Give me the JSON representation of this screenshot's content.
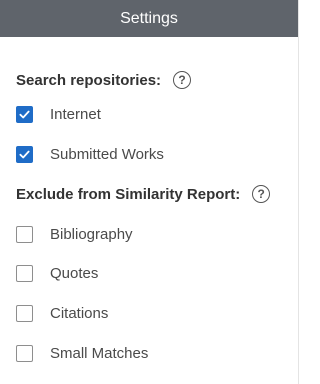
{
  "header": {
    "title": "Settings"
  },
  "search_repositories": {
    "title": "Search repositories:",
    "help_icon": "help-circle-icon",
    "options": [
      {
        "label": "Internet",
        "checked": true
      },
      {
        "label": "Submitted Works",
        "checked": true
      }
    ]
  },
  "exclude": {
    "title": "Exclude from Similarity Report:",
    "help_icon": "help-circle-icon",
    "options": [
      {
        "label": "Bibliography",
        "checked": false
      },
      {
        "label": "Quotes",
        "checked": false
      },
      {
        "label": "Citations",
        "checked": false
      },
      {
        "label": "Small Matches",
        "checked": false
      }
    ]
  },
  "colors": {
    "header_bg": "#5f646b",
    "checkbox_checked": "#1f6cc7"
  }
}
